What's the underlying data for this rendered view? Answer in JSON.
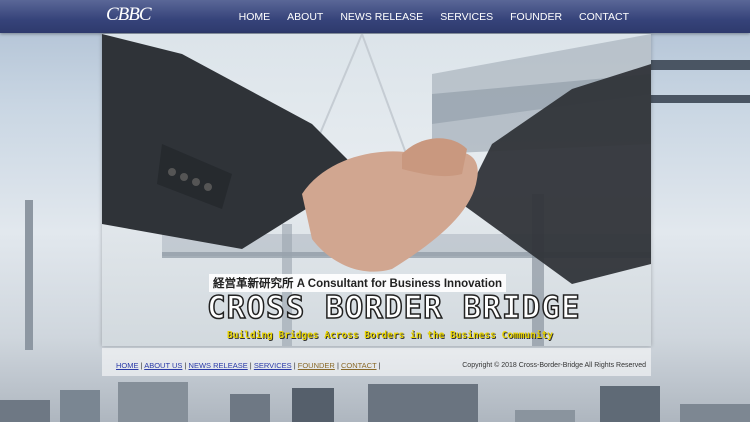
{
  "header": {
    "logo": "CBBC",
    "nav": [
      "HOME",
      "ABOUT",
      "NEWS RELEASE",
      "SERVICES",
      "FOUNDER",
      "CONTACT"
    ]
  },
  "hero": {
    "tagline": "経営革新研究所  A Consultant for Business Innovation",
    "title": "CROSS BORDER BRIDGE",
    "subtitle": "Building Bridges Across Borders in the Business Community"
  },
  "footer": {
    "links": [
      "HOME",
      "ABOUT US",
      "NEWS RELEASE",
      "SERVICES",
      "FOUNDER",
      "CONTACT"
    ],
    "copyright": "Copyright © 2018 Cross-Border-Bridge All Rights Reserved"
  },
  "colors": {
    "header": "#36437a",
    "footer_link": "#2a3aa8",
    "subtitle": "#e8d300"
  }
}
